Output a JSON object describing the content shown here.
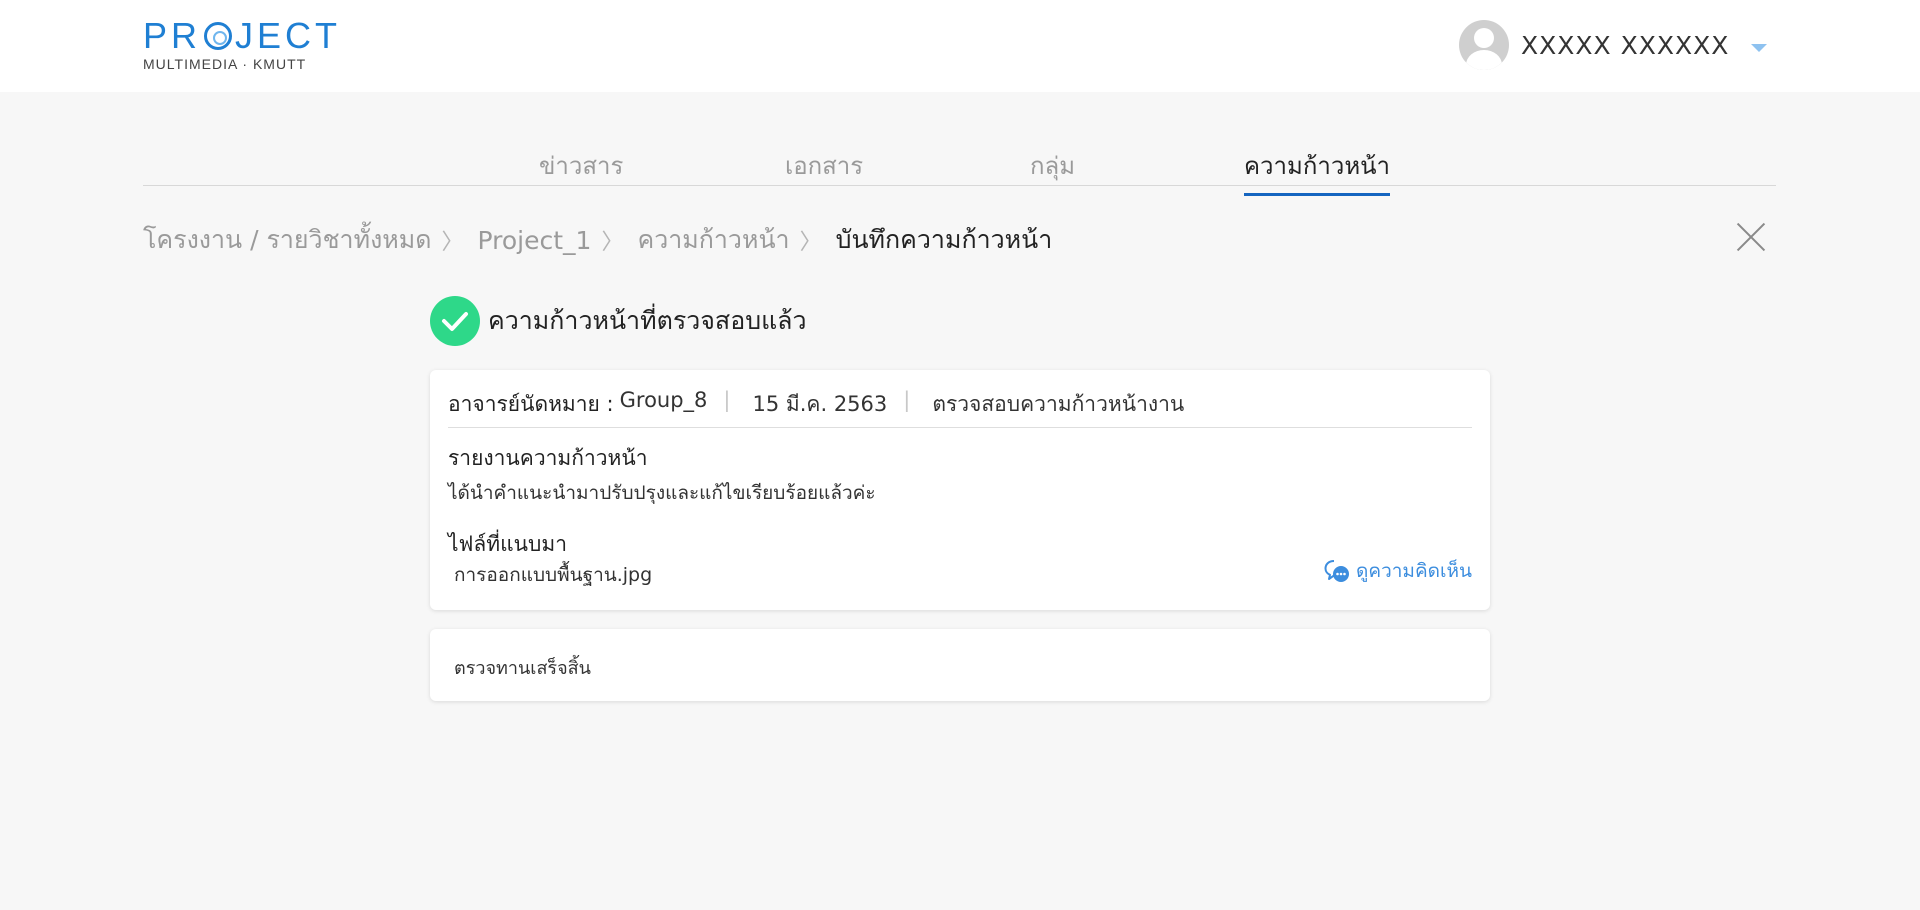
{
  "header": {
    "logo_title": "PROJECT",
    "logo_subtitle": "MULTIMEDIA · KMUTT",
    "user_name": "XXXXX XXXXXX"
  },
  "tabs": [
    {
      "label": "ข่าวสาร",
      "active": false
    },
    {
      "label": "เอกสาร",
      "active": false
    },
    {
      "label": "กลุ่ม",
      "active": false
    },
    {
      "label": "ความก้าวหน้า",
      "active": true
    }
  ],
  "breadcrumb": {
    "items": [
      "โครงงาน / รายวิชาทั้งหมด",
      "Project_1",
      "ความก้าวหน้า"
    ],
    "current": "บันทึกความก้าวหน้า",
    "separator": "〉"
  },
  "status": {
    "text": "ความก้าวหน้าที่ตรวจสอบแล้ว",
    "color": "#2ed889"
  },
  "progress_card": {
    "advisor_label": "อาจารย์นัดหมาย :",
    "group": "Group_8",
    "date": "15 มี.ค. 2563",
    "topic": "ตรวจสอบความก้าวหน้างาน",
    "report_title": "รายงานความก้าวหน้า",
    "report_text": "ได้นำคำแนะนำมาปรับปรุงและแก้ไขเรียบร้อยแล้วค่ะ",
    "files_title": "ไฟล์ที่แนบมา",
    "file_name": "การออกแบบพื้นฐาน.jpg",
    "comment_link": "ดูความคิดเห็น"
  },
  "review_card": {
    "text": "ตรวจทานเสร็จสิ้น"
  },
  "colors": {
    "accent": "#1565c0",
    "link": "#3c8dde",
    "logo": "#1f7fd3"
  }
}
